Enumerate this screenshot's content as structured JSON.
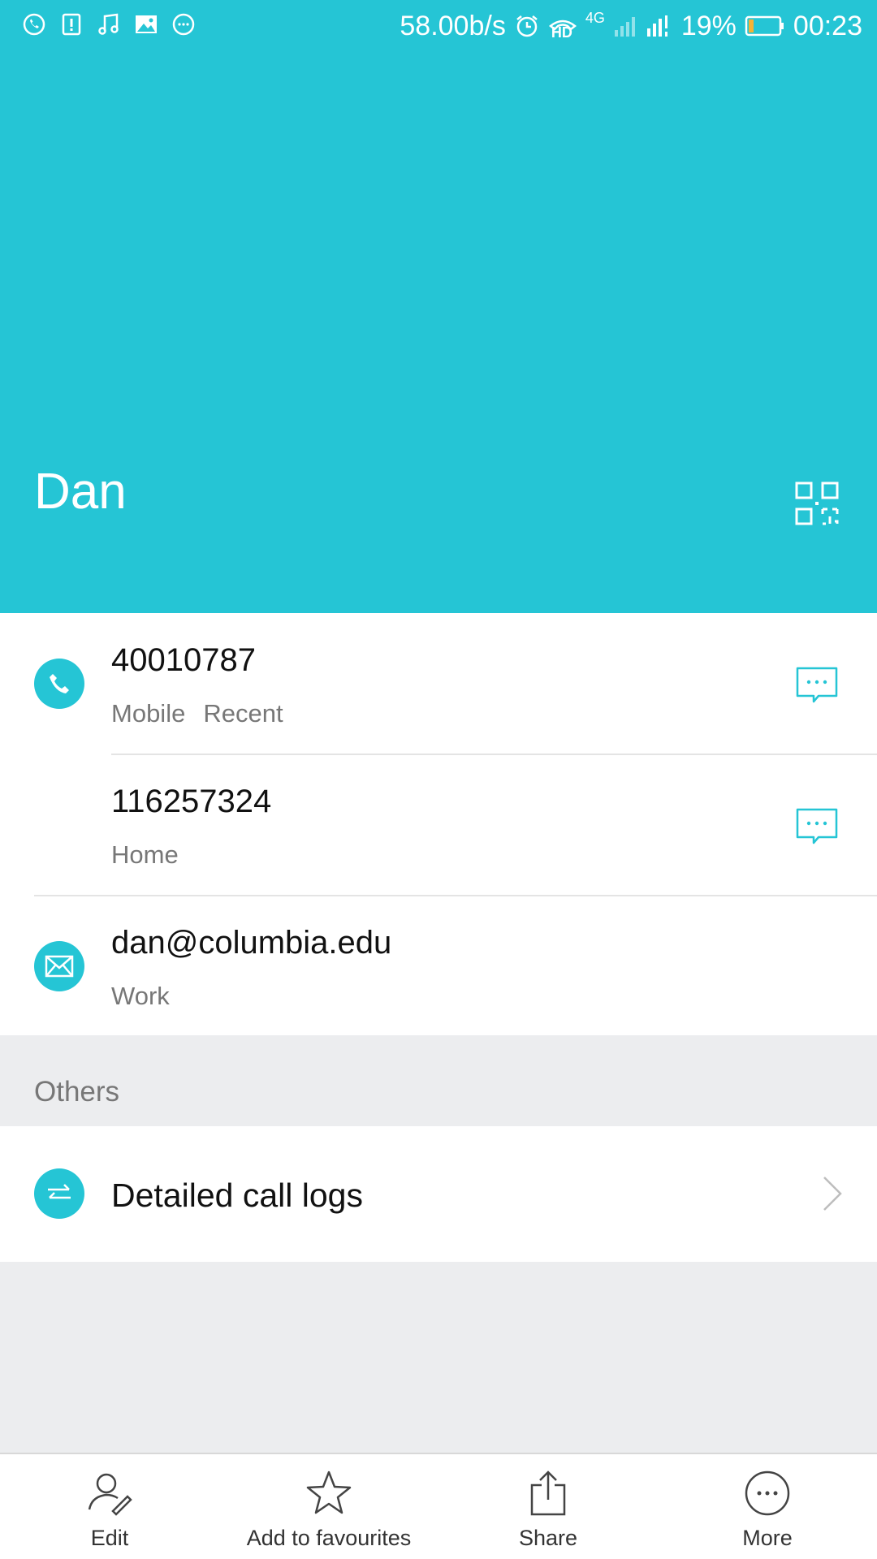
{
  "status_bar": {
    "net_speed": "58.00b/s",
    "hd_label": "HD",
    "network_type": "4G",
    "battery_percent": "19%",
    "time": "00:23"
  },
  "contact": {
    "name": "Dan"
  },
  "details": {
    "phone1": {
      "number": "40010787",
      "type": "Mobile",
      "tag": "Recent"
    },
    "phone2": {
      "number": "116257324",
      "type": "Home"
    },
    "email": {
      "address": "dan@columbia.edu",
      "type": "Work"
    }
  },
  "others": {
    "section_title": "Others",
    "call_logs_label": "Detailed call logs"
  },
  "bottom_bar": {
    "edit": "Edit",
    "favourite": "Add to favourites",
    "share": "Share",
    "more": "More"
  },
  "colors": {
    "accent": "#25C5D5",
    "background": "#ECEDEF"
  }
}
